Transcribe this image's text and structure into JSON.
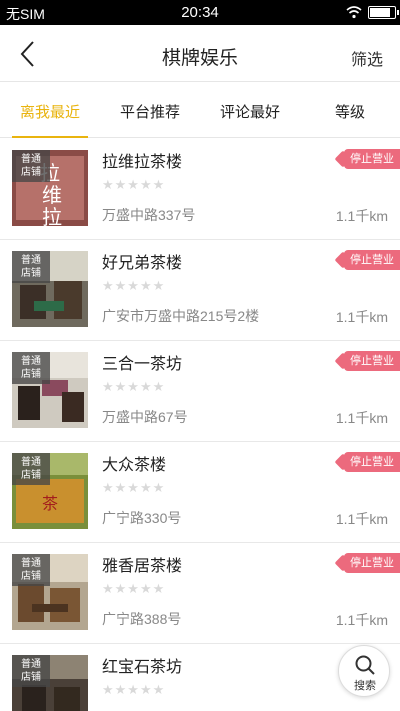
{
  "status_bar": {
    "carrier": "无SIM",
    "time": "20:34",
    "battery_level": 0.85
  },
  "header": {
    "title": "棋牌娱乐",
    "filter_label": "筛选"
  },
  "tabs": [
    {
      "label": "离我最近",
      "active": true
    },
    {
      "label": "平台推荐",
      "active": false
    },
    {
      "label": "评论最好",
      "active": false
    },
    {
      "label": "等级",
      "active": false
    }
  ],
  "listings": [
    {
      "name": "拉维拉茶楼",
      "address": "万盛中路337号",
      "distance": "1.1千km",
      "badge": [
        "普通",
        "店铺"
      ],
      "status": "停止营业",
      "stars": "★★★★★",
      "rating": 0
    },
    {
      "name": "好兄弟茶楼",
      "address": "广安市万盛中路215号2楼",
      "distance": "1.1千km",
      "badge": [
        "普通",
        "店铺"
      ],
      "status": "停止营业",
      "stars": "★★★★★",
      "rating": 0
    },
    {
      "name": "三合一茶坊",
      "address": "万盛中路67号",
      "distance": "1.1千km",
      "badge": [
        "普通",
        "店铺"
      ],
      "status": "停止营业",
      "stars": "★★★★★",
      "rating": 0
    },
    {
      "name": "大众茶楼",
      "address": "广宁路330号",
      "distance": "1.1千km",
      "badge": [
        "普通",
        "店铺"
      ],
      "status": "停止营业",
      "stars": "★★★★★",
      "rating": 0
    },
    {
      "name": "雅香居茶楼",
      "address": "广宁路388号",
      "distance": "1.1千km",
      "badge": [
        "普通",
        "店铺"
      ],
      "status": "停止营业",
      "stars": "★★★★★",
      "rating": 0
    },
    {
      "name": "红宝石茶坊",
      "address": "",
      "distance": "",
      "badge": [
        "普通",
        "店铺"
      ],
      "status": "",
      "stars": "★★★★★",
      "rating": 0
    }
  ],
  "search_fab": {
    "label": "搜索"
  },
  "colors": {
    "accent": "#e9b40f",
    "status_tag": "#ec6a7d",
    "star_empty": "#d9d9d9"
  },
  "icons": {
    "back": "chevron-left-icon",
    "search": "search-icon",
    "wifi": "wifi-icon",
    "battery": "battery-icon"
  }
}
